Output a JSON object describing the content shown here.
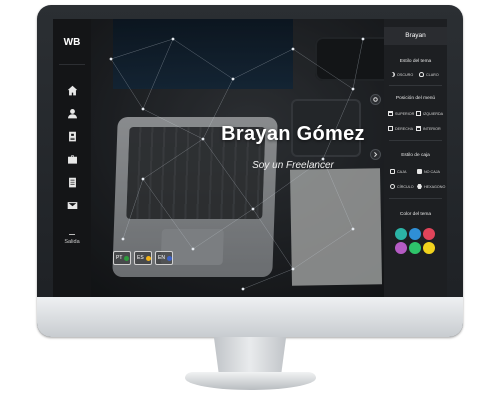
{
  "nav": {
    "brand": "WB",
    "items": [
      {
        "icon": "home-icon"
      },
      {
        "icon": "user-icon"
      },
      {
        "icon": "id-card-icon"
      },
      {
        "icon": "briefcase-icon"
      },
      {
        "icon": "document-icon"
      },
      {
        "icon": "envelope-icon"
      }
    ],
    "logout_label": "Salida"
  },
  "hero": {
    "name": "Brayan Gómez",
    "subtitle": "Soy un Freelancer"
  },
  "languages": [
    {
      "code": "PT"
    },
    {
      "code": "ES"
    },
    {
      "code": "EN"
    }
  ],
  "panel": {
    "name": "Brayan",
    "theme_style": {
      "title": "Estilo del tema",
      "options": [
        "OSCURO",
        "CLARO"
      ]
    },
    "menu_position": {
      "title": "Posición del menú",
      "options": [
        "SUPERIOR",
        "IZQUIERDA",
        "DERECHA",
        "INTERIOR"
      ]
    },
    "box_style": {
      "title": "Estilo de caja",
      "options": [
        "CAJA",
        "NO CAJA",
        "CÍRCULO",
        "HEXAGONO"
      ]
    },
    "theme_color": {
      "title": "Color del tema"
    },
    "colors": [
      "#2bb3a6",
      "#2f8fd6",
      "#e0445a",
      "#b55bc4",
      "#2ec46a",
      "#f1d21d"
    ]
  }
}
